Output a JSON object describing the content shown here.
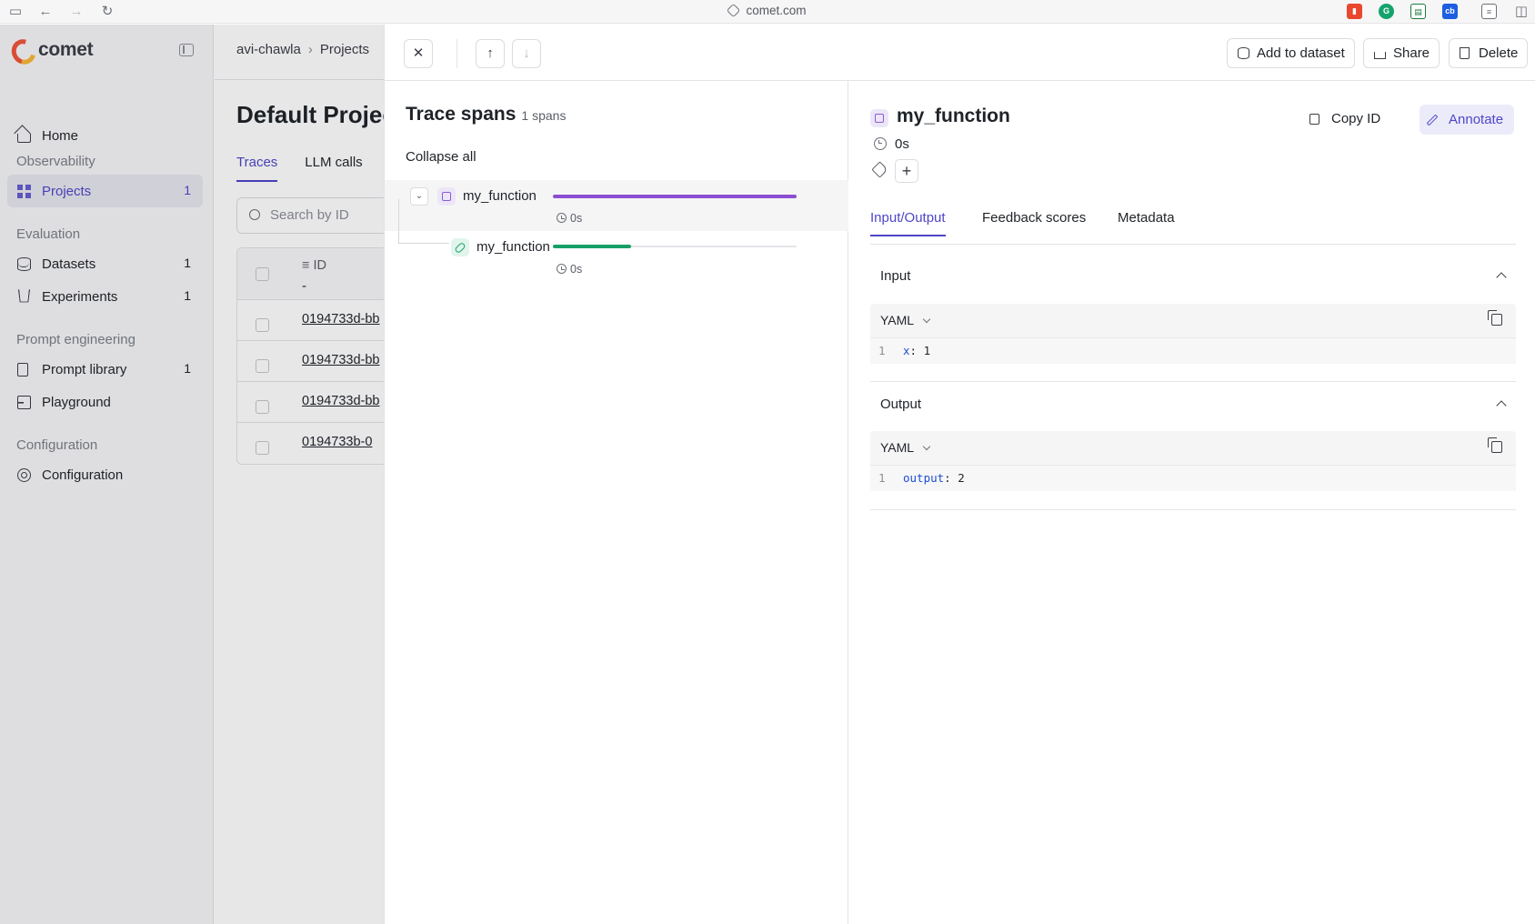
{
  "browser": {
    "url": "comet.com"
  },
  "sidebar": {
    "brand": "comet",
    "home": "Home",
    "sections": {
      "observability": "Observability",
      "evaluation": "Evaluation",
      "prompt_engineering": "Prompt engineering",
      "configuration": "Configuration"
    },
    "items": {
      "projects": {
        "label": "Projects",
        "count": "1"
      },
      "datasets": {
        "label": "Datasets",
        "count": "1"
      },
      "experiments": {
        "label": "Experiments",
        "count": "1"
      },
      "prompt_library": {
        "label": "Prompt library",
        "count": "1"
      },
      "playground": {
        "label": "Playground"
      },
      "configuration": {
        "label": "Configuration"
      }
    }
  },
  "background": {
    "breadcrumb": [
      "avi-chawla",
      "Projects"
    ],
    "title": "Default Project",
    "tabs": [
      "Traces",
      "LLM calls"
    ],
    "search_placeholder": "Search by ID",
    "table": {
      "id_header": "ID",
      "id_sub": "-",
      "rows": [
        "0194733d-bb",
        "0194733d-bb",
        "0194733d-bb",
        "0194733b-0"
      ]
    }
  },
  "drawer": {
    "close": "✕",
    "prev": "↑",
    "next": "↓",
    "actions": {
      "add_to_dataset": "Add to dataset",
      "share": "Share",
      "delete": "Delete"
    },
    "trace_spans": {
      "title": "Trace spans",
      "count": "1 spans",
      "collapse_all": "Collapse all",
      "spans": [
        {
          "name": "my_function",
          "duration": "0s",
          "type": "general",
          "bar_fraction": 1.0,
          "bar_color": "#8c4fd1"
        },
        {
          "name": "my_function",
          "duration": "0s",
          "type": "llm",
          "bar_fraction": 0.32,
          "bar_color": "#16a067"
        }
      ]
    },
    "detail": {
      "name": "my_function",
      "duration": "0s",
      "copy_id": "Copy ID",
      "annotate": "Annotate",
      "tabs": [
        "Input/Output",
        "Feedback scores",
        "Metadata"
      ],
      "input": {
        "label": "Input",
        "format": "YAML",
        "line_no": "1",
        "key": "x",
        "value": "1"
      },
      "output": {
        "label": "Output",
        "format": "YAML",
        "line_no": "1",
        "key": "output",
        "value": "2"
      }
    }
  },
  "colors": {
    "accent": "#4f46c8",
    "span_general": "#8c4fd1",
    "span_llm": "#16a067"
  }
}
